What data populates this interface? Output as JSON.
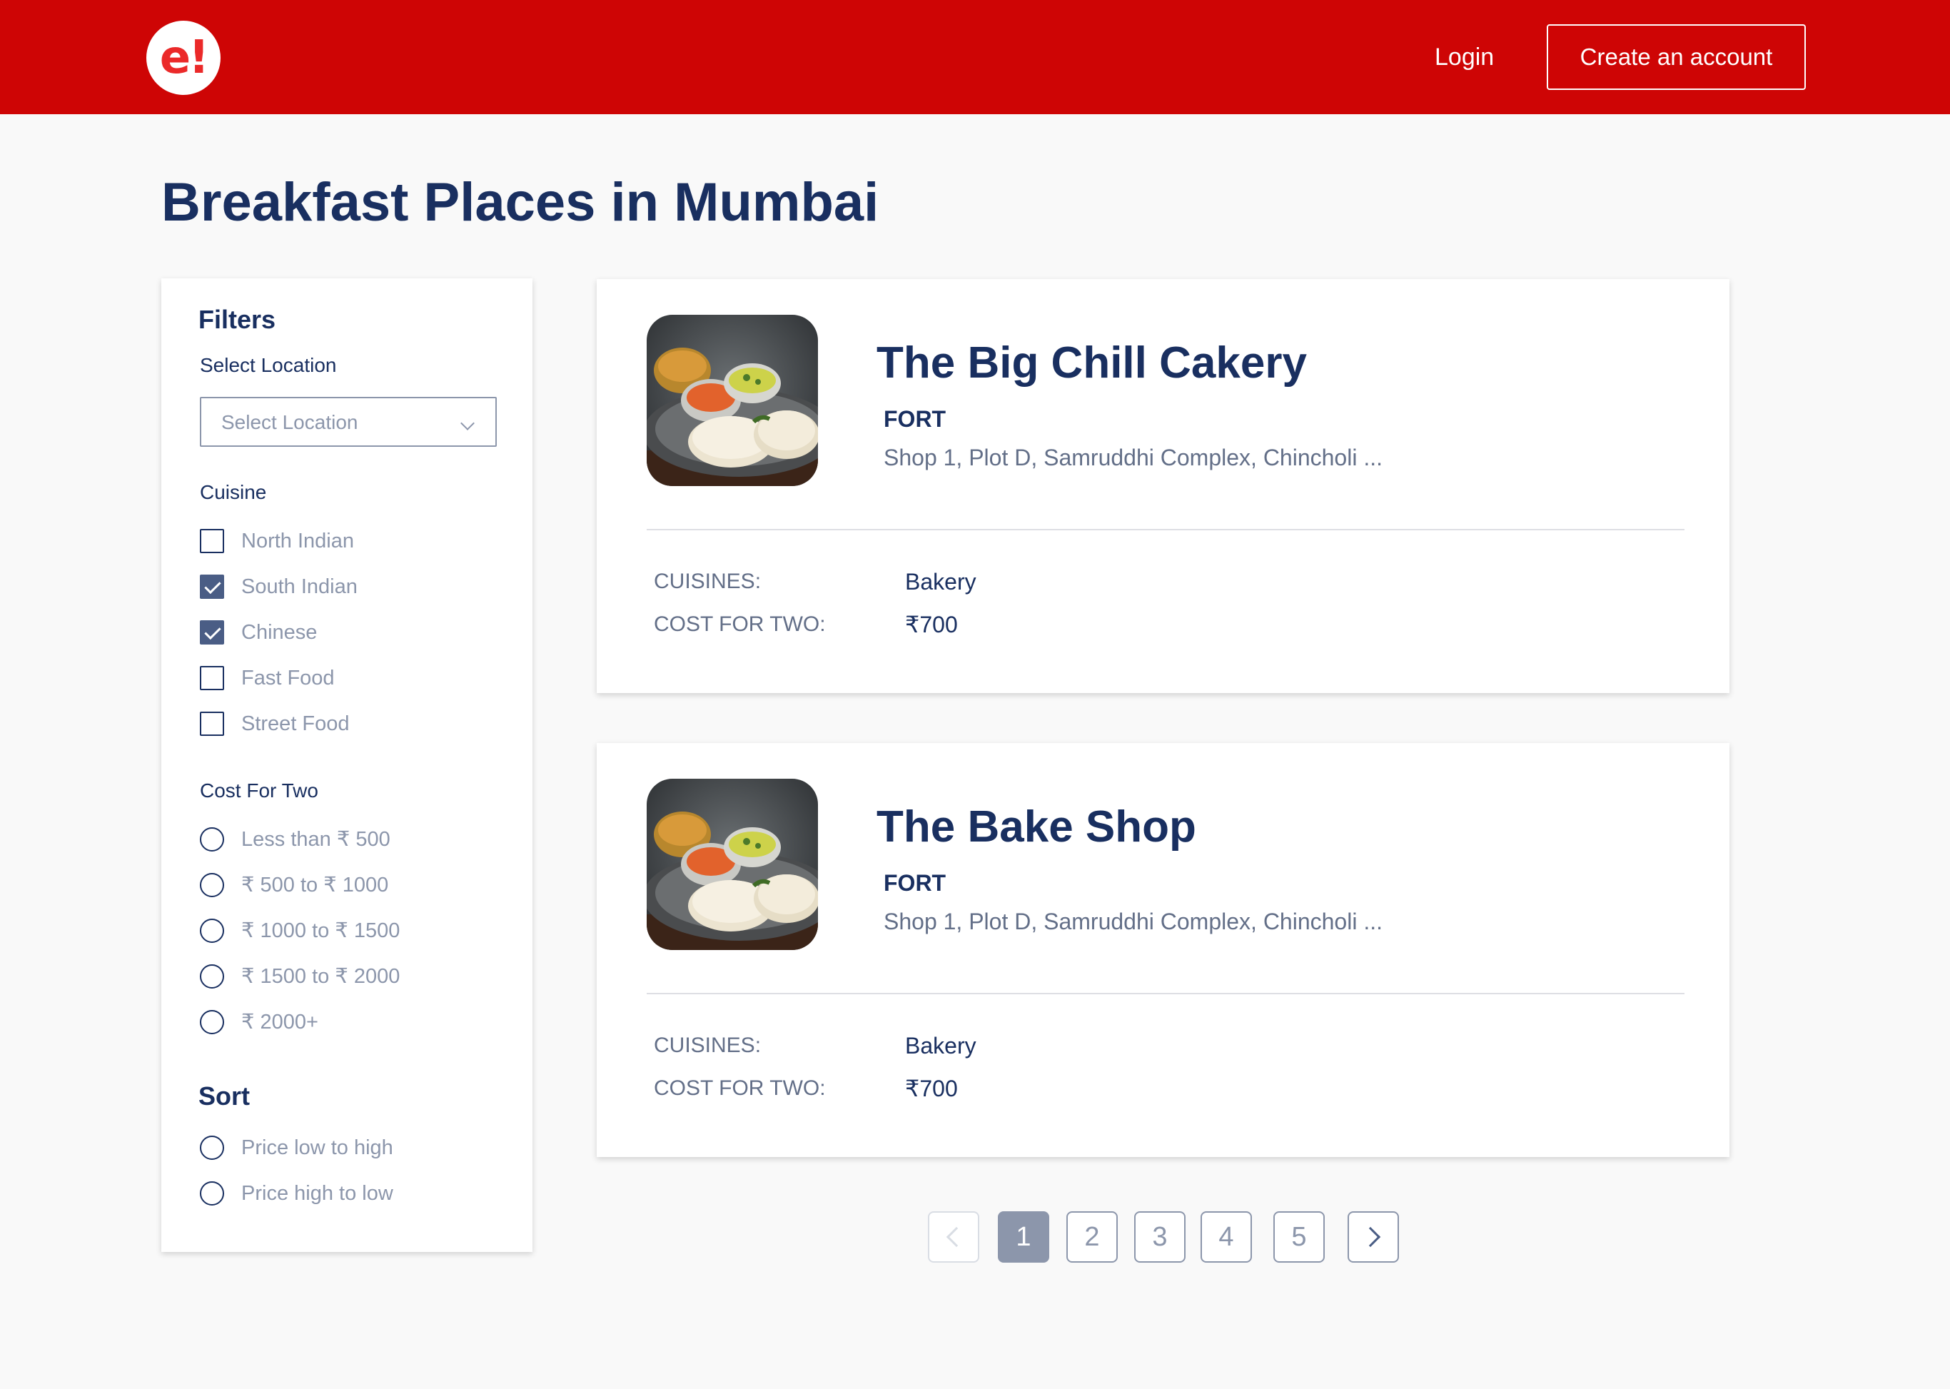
{
  "header": {
    "logo_text": "e!",
    "login_label": "Login",
    "create_account_label": "Create an account",
    "brand_color": "#ce0505"
  },
  "page": {
    "title": "Breakfast Places in Mumbai"
  },
  "filters": {
    "title": "Filters",
    "location_label": "Select Location",
    "location_placeholder": "Select Location",
    "cuisine_label": "Cuisine",
    "cuisines": [
      {
        "label": "North Indian",
        "checked": false
      },
      {
        "label": "South Indian",
        "checked": true
      },
      {
        "label": "Chinese",
        "checked": true
      },
      {
        "label": "Fast Food",
        "checked": false
      },
      {
        "label": "Street Food",
        "checked": false
      }
    ],
    "cost_label": "Cost For Two",
    "costs": [
      {
        "label": "Less than ₹ 500"
      },
      {
        "label": "₹ 500 to ₹ 1000"
      },
      {
        "label": "₹ 1000 to ₹ 1500"
      },
      {
        "label": "₹ 1500 to ₹ 2000"
      },
      {
        "label": "₹ 2000+"
      }
    ],
    "sort_title": "Sort",
    "sorts": [
      {
        "label": "Price low to high"
      },
      {
        "label": "Price high to low"
      }
    ]
  },
  "results": [
    {
      "name": "The Big Chill Cakery",
      "locality": "FORT",
      "address": "Shop 1, Plot D, Samruddhi Complex, Chincholi ...",
      "cuisines_key": "CUISINES:",
      "cuisines_value": "Bakery",
      "cost_key": "COST FOR TWO:",
      "cost_value": "₹700",
      "image_icon": "idli-plate-photo"
    },
    {
      "name": "The Bake Shop",
      "locality": "FORT",
      "address": "Shop 1, Plot D, Samruddhi Complex, Chincholi ...",
      "cuisines_key": "CUISINES:",
      "cuisines_value": "Bakery",
      "cost_key": "COST FOR TWO:",
      "cost_value": "₹700",
      "image_icon": "idli-plate-photo"
    }
  ],
  "pagination": {
    "pages": [
      "1",
      "2",
      "3",
      "4",
      "5"
    ],
    "current_page": "1"
  }
}
